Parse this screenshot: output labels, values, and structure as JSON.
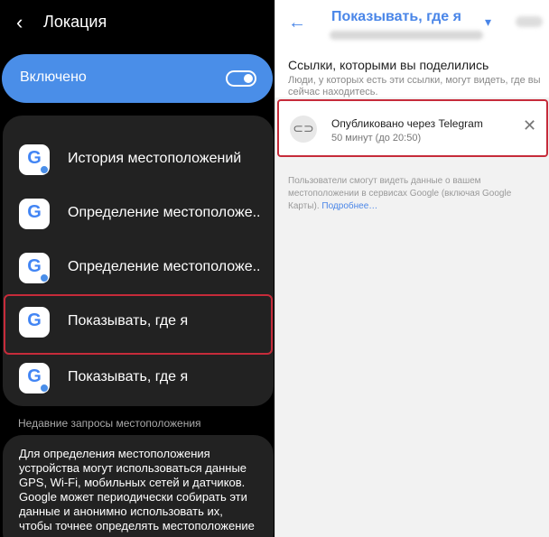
{
  "left": {
    "title": "Локация",
    "toggle_label": "Включено",
    "items": [
      {
        "label": "История местоположений"
      },
      {
        "label": "Определение местоположе.."
      },
      {
        "label": "Определение местоположе.."
      },
      {
        "label": "Показывать, где я"
      },
      {
        "label": "Показывать, где я"
      }
    ],
    "recent_label": "Недавние запросы местоположения",
    "info_text": "Для определения местоположения устройства могут использоваться данные GPS, Wi-Fi, мобильных сетей и датчиков. Google может периодически собирать эти данные и анонимно использовать их, чтобы точнее определять местоположение и улучшать"
  },
  "right": {
    "title": "Показывать, где я",
    "shared_title": "Ссылки, которыми вы поделились",
    "shared_sub": "Люди, у которых есть эти ссылки, могут видеть, где вы сейчас находитесь.",
    "share_title": "Опубликовано через Telegram",
    "share_time": "50 минут (до 20:50)",
    "note": "Пользователи смогут видеть данные о вашем местоположении в сервисах Google (включая Google Карты).",
    "more": "Подробнее…"
  },
  "icons": {
    "back": "back-arrow-icon",
    "google": "google-g-icon",
    "link": "link-icon",
    "close": "close-icon"
  },
  "colors": {
    "accent": "#4a8ee8",
    "highlight": "#c62b3a"
  }
}
